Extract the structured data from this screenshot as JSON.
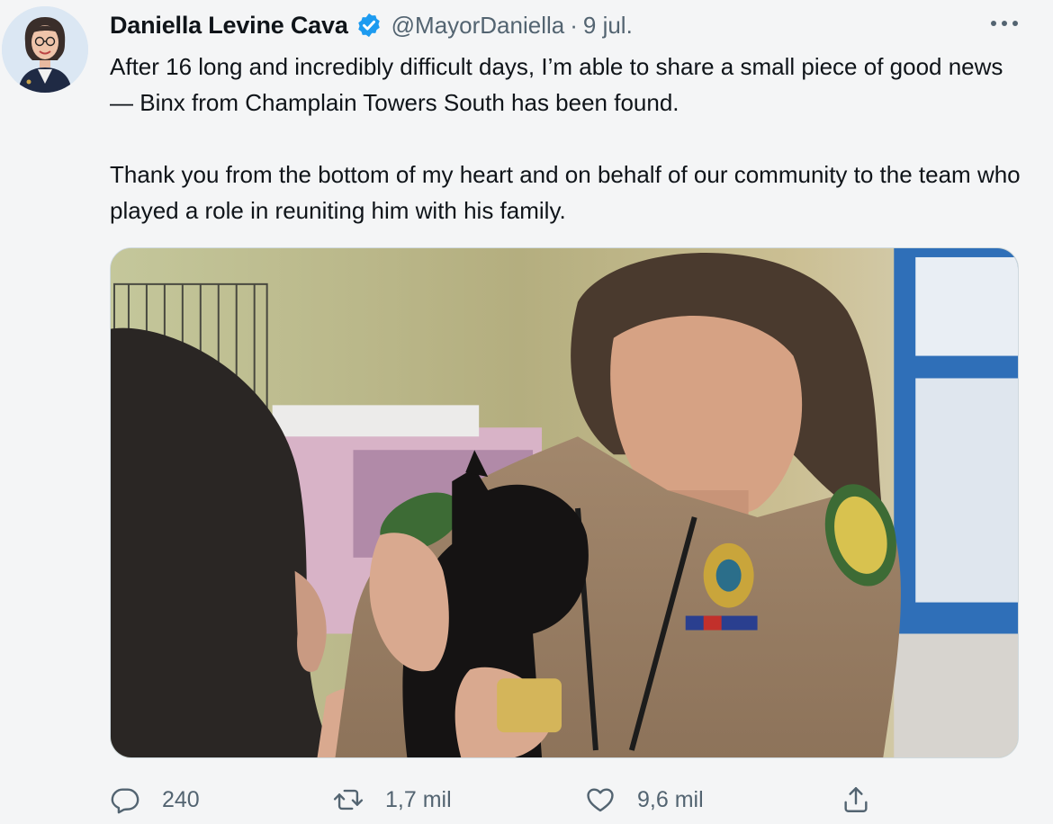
{
  "tweet": {
    "author_name": "Daniella Levine Cava",
    "handle": "@MayorDaniella",
    "separator": "·",
    "date": "9 jul.",
    "paragraphs": [
      "After 16 long and incredibly difficult days, I’m able to share a small piece of good news — Binx from Champlain Towers South has been found.",
      "Thank you from the bottom of my heart and on behalf of our community to the team who played a role in reuniting him with his family."
    ],
    "icons": {
      "verified": "verified-badge-icon",
      "more": "more-options-icon",
      "reply": "reply-icon",
      "retweet": "retweet-icon",
      "like": "heart-icon",
      "share": "share-icon"
    },
    "actions": {
      "replies": "240",
      "retweets": "1,7 mil",
      "likes": "9,6 mil"
    },
    "colors": {
      "verified": "#1d9bf0",
      "text": "#0f1419",
      "secondary": "#536471",
      "background": "#f4f5f6"
    }
  }
}
